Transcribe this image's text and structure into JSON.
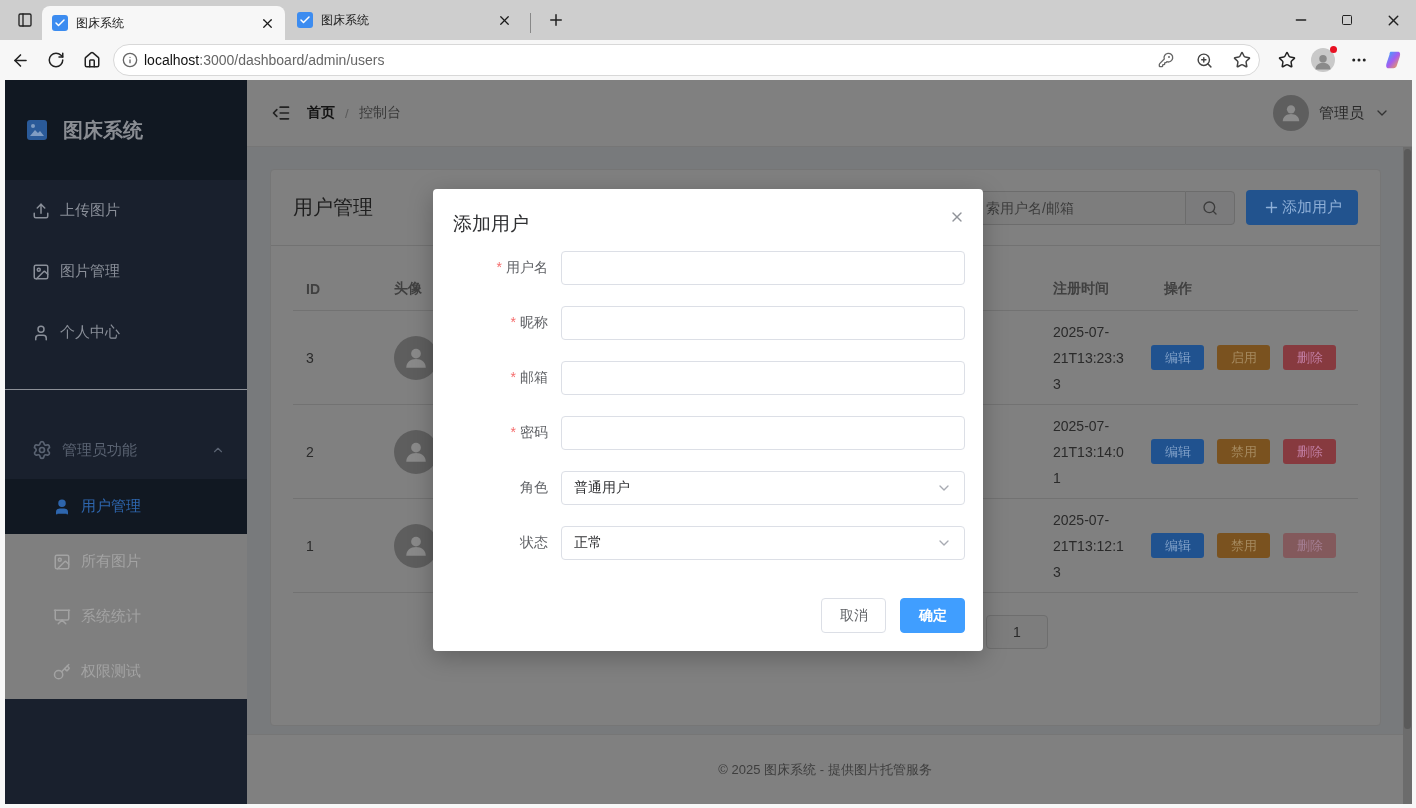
{
  "browser": {
    "tabs": [
      {
        "title": "图床系统",
        "selected": true
      },
      {
        "title": "图床系统",
        "selected": false
      }
    ],
    "url": {
      "host": "localhost",
      "path": ":3000/dashboard/admin/users"
    }
  },
  "sidebar": {
    "logo_text": "图床系统",
    "items": [
      {
        "label": "上传图片",
        "selected": false
      },
      {
        "label": "图片管理",
        "selected": false
      },
      {
        "label": "个人中心",
        "selected": false
      }
    ],
    "group": {
      "label": "管理员功能",
      "expanded": true,
      "children": [
        {
          "label": "用户管理",
          "selected": true
        },
        {
          "label": "所有图片",
          "selected": false
        },
        {
          "label": "系统统计",
          "selected": false
        },
        {
          "label": "权限测试",
          "selected": false
        }
      ]
    }
  },
  "header": {
    "breadcrumb": [
      "首页",
      "控制台"
    ],
    "separator": "/",
    "user": {
      "name": "管理员"
    }
  },
  "card": {
    "title": "用户管理",
    "search": {
      "placeholder": "索用户名/邮箱"
    },
    "add_button": "添加用户",
    "table": {
      "columns": [
        "ID",
        "头像",
        "注册时间",
        "操作"
      ],
      "rows": [
        {
          "id": "3",
          "registered": "2025-07-21T13:23:33",
          "actions": [
            {
              "label": "编辑",
              "kind": "edit",
              "disabled": false
            },
            {
              "label": "启用",
              "kind": "toggle",
              "disabled": false
            },
            {
              "label": "删除",
              "kind": "delete",
              "disabled": false
            }
          ]
        },
        {
          "id": "2",
          "registered": "2025-07-21T13:14:01",
          "actions": [
            {
              "label": "编辑",
              "kind": "edit",
              "disabled": false
            },
            {
              "label": "禁用",
              "kind": "toggle",
              "disabled": false
            },
            {
              "label": "删除",
              "kind": "delete",
              "disabled": false
            }
          ]
        },
        {
          "id": "1",
          "registered": "2025-07-21T13:12:13",
          "actions": [
            {
              "label": "编辑",
              "kind": "edit",
              "disabled": false
            },
            {
              "label": "禁用",
              "kind": "toggle",
              "disabled": false
            },
            {
              "label": "删除",
              "kind": "delete",
              "disabled": true
            }
          ]
        }
      ]
    },
    "pagination": {
      "pages": [
        "1"
      ]
    }
  },
  "footer": "© 2025 图床系统 - 提供图片托管服务",
  "modal": {
    "title": "添加用户",
    "required_mark": "*",
    "fields": [
      {
        "label": "用户名",
        "required": true,
        "kind": "input"
      },
      {
        "label": "昵称",
        "required": true,
        "kind": "input"
      },
      {
        "label": "邮箱",
        "required": true,
        "kind": "input"
      },
      {
        "label": "密码",
        "required": true,
        "kind": "input"
      },
      {
        "label": "角色",
        "required": false,
        "kind": "select",
        "value": "普通用户"
      },
      {
        "label": "状态",
        "required": false,
        "kind": "select",
        "value": "正常"
      }
    ],
    "buttons": [
      {
        "label": "取消",
        "kind": "secondary"
      },
      {
        "label": "确定",
        "kind": "primary"
      }
    ]
  }
}
